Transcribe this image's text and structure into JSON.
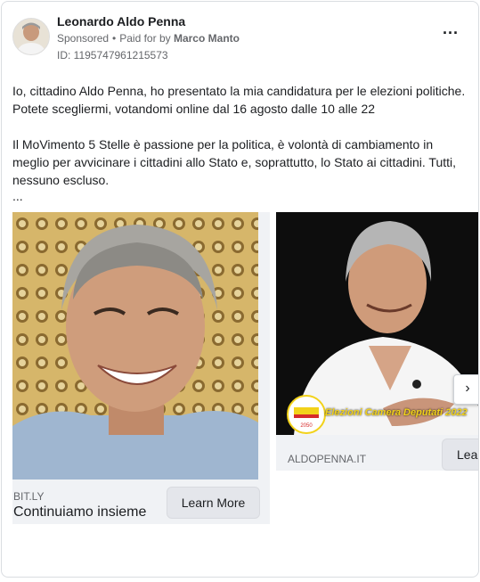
{
  "author": {
    "name": "Leonardo Aldo Penna",
    "sponsored": "Sponsored",
    "paid_prefix": "Paid for by",
    "payer": "Marco Manto",
    "ad_id": "ID: 1195747961215573"
  },
  "menu": {
    "more_icon": "more-horizontal-icon",
    "more_glyph": "···"
  },
  "body": {
    "line1": "Io, cittadino Aldo Penna, ho presentato la mia candidatura per le elezioni politiche.",
    "line2": "Potete scegliermi, votandomi online dal 16 agosto dalle 10 alle 22",
    "line3": "Il MoVimento 5 Stelle è passione per la politica, è volontà di cambiamento in",
    "line4": "meglio per avvicinare i cittadini allo Stato e, soprattutto, lo Stato ai cittadini. Tutti,",
    "line5": "nessuno escluso.",
    "ellipsis": "..."
  },
  "carousel": {
    "cards": [
      {
        "domain": "BIT.LY",
        "headline": "Continuiamo insieme",
        "cta": "Learn More"
      },
      {
        "domain": "ALDOPENNA.IT",
        "cta": "Learn More",
        "overlay_text": "Elezioni Camera Deputati 2022",
        "logo_year": "2050"
      }
    ],
    "next_glyph": "›"
  }
}
